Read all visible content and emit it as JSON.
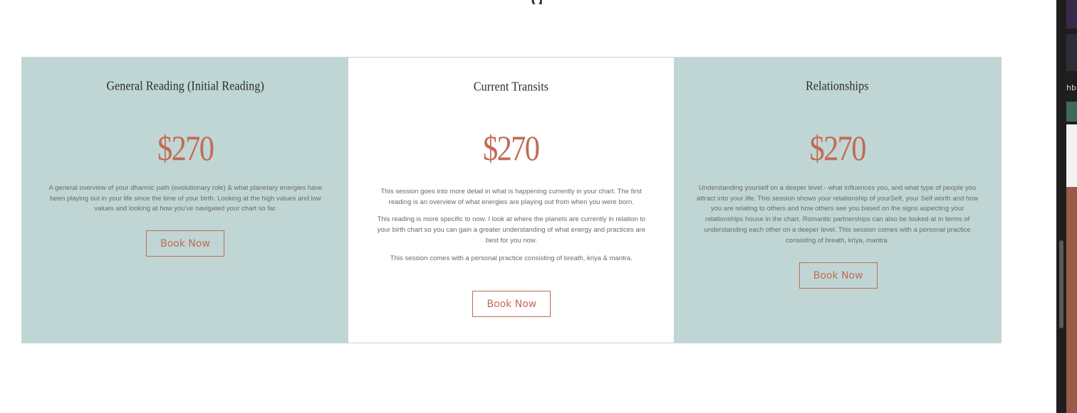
{
  "heading_fragment": "g",
  "cards": [
    {
      "title": "General Reading (Initial Reading)",
      "price": "$270",
      "paragraphs": [
        "A general overview of your dharmic path (evolutionary role) & what planetary energies have been playing out in your life since the time of your birth. Looking at the high values and low values and looking at how you've navigated your chart so far."
      ],
      "button": "Book Now"
    },
    {
      "title": "Current Transits",
      "price": "$270",
      "paragraphs": [
        "This session goes into more detail in what is happening currently in your chart.   The first reading is an overview of what energies are playing out from when you were born.",
        "This reading is more specific to now. I look at where the planets are currently in relation to your birth chart so you can gain a greater understanding of what energy and practices are best for you now.",
        "This session comes with a personal practice consisting of breath, kriya & mantra."
      ],
      "button": "Book Now"
    },
    {
      "title": "Relationships",
      "price": "$270",
      "paragraphs": [
        "Understanding yourself on a deeper level -  what influences you, and what type of people you attract into your life. This session shows your relationship of yourSelf, your Self worth and how you are relating to others and how others see you based on the signs aspecting your relationships house in the chart. Romantic partnerships can also be looked at in terms of understanding each other on a deeper level. This session comes with a personal practice consisting of breath, kriya, mantra."
      ],
      "button": "Book Now"
    }
  ],
  "browser_side": {
    "label": "hb"
  },
  "colors": {
    "teal": "#c0d6d4",
    "accent": "#c26b55",
    "text": "#2b2b2b",
    "body_text": "#6a6a6a"
  }
}
